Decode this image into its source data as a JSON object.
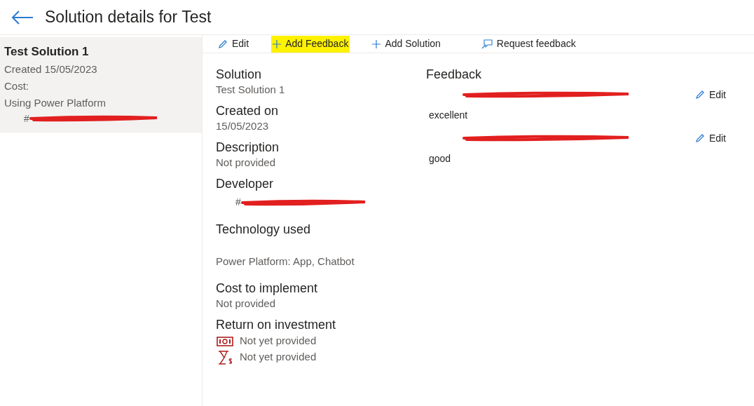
{
  "header": {
    "title": "Solution details for Test"
  },
  "sidebar": {
    "items": [
      {
        "title": "Test Solution 1",
        "created": "Created 15/05/2023",
        "cost": "Cost:",
        "technology": "Using Power Platform",
        "developer_prefix": "#",
        "selected": true
      }
    ]
  },
  "toolbar": [
    {
      "kind": "edit",
      "label": "Edit",
      "highlighted": false
    },
    {
      "kind": "add",
      "label": "Add Feedback",
      "highlighted": true
    },
    {
      "kind": "add",
      "label": "Add Solution",
      "highlighted": false
    },
    {
      "kind": "request",
      "label": "Request feedback",
      "highlighted": false
    }
  ],
  "details": [
    {
      "kind": "text",
      "label": "Solution",
      "value": "Test Solution 1"
    },
    {
      "kind": "text",
      "label": "Created on",
      "value": "15/05/2023"
    },
    {
      "kind": "text",
      "label": "Description",
      "value": "Not provided"
    },
    {
      "kind": "person",
      "label": "Developer",
      "value": "#"
    },
    {
      "kind": "spaced",
      "label": "Technology used",
      "value": "Power Platform: App, Chatbot"
    },
    {
      "kind": "text",
      "label": "Cost to implement",
      "value": "Not provided"
    },
    {
      "kind": "roi",
      "label": "Return on investment",
      "rows": [
        {
          "kind": "money",
          "value": "Not yet provided"
        },
        {
          "kind": "time",
          "value": "Not yet provided"
        }
      ]
    }
  ],
  "feedback": {
    "title": "Feedback",
    "items": [
      {
        "comment": "excellent",
        "edit_label": "Edit"
      },
      {
        "comment": "good",
        "edit_label": "Edit"
      }
    ]
  }
}
